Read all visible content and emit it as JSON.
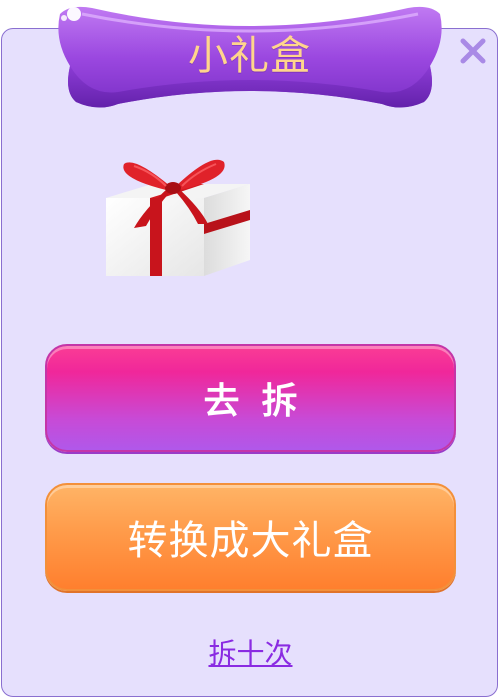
{
  "dialog": {
    "title": "小礼盒",
    "close_icon": "close-icon",
    "gift_icon": "gift-box-icon"
  },
  "actions": {
    "open_label": "去拆",
    "convert_label": "转换成大礼盒",
    "open_ten_label": "拆十次"
  },
  "colors": {
    "background": "#e6e0fd",
    "ribbon": "#9b48e0",
    "title_text": "#ffd58c",
    "open_button": "#f0279a",
    "convert_button": "#ff9b4a",
    "link": "#8a2be2",
    "close": "#a98ae6"
  }
}
